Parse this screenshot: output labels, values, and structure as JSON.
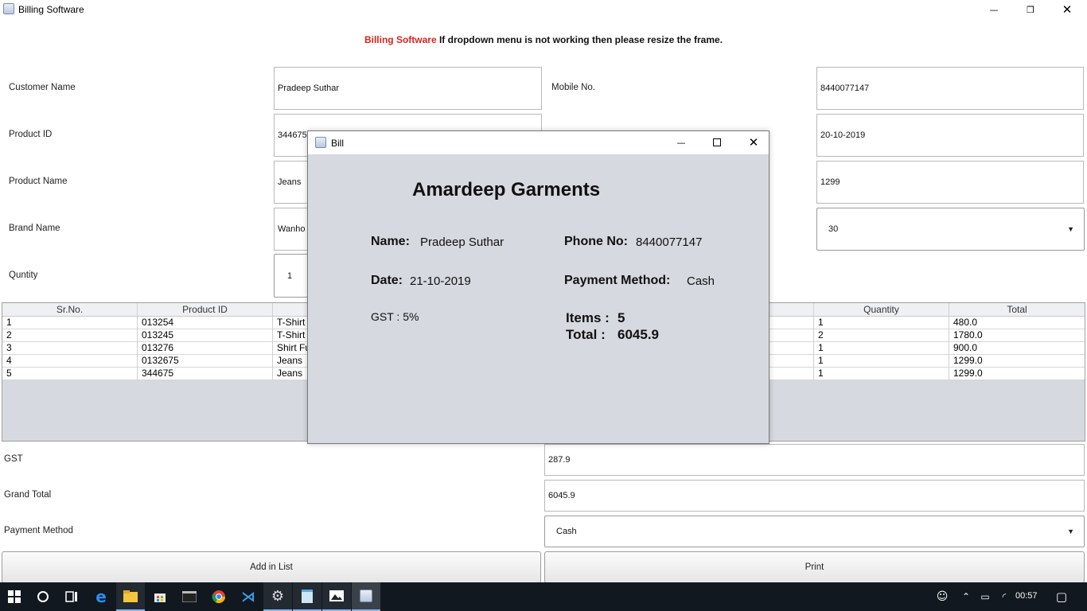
{
  "window": {
    "title": "Billing Software",
    "minimize_glyph": "—",
    "restore_glyph": "❐",
    "close_glyph": "✕"
  },
  "banner": {
    "highlight": "Billing Software",
    "message": " If dropdown menu is not working then please resize the frame."
  },
  "form": {
    "customer_name_label": "Customer Name",
    "customer_name_value": "Pradeep Suthar",
    "mobile_label": "Mobile No.",
    "mobile_value": "8440077147",
    "product_id_label": "Product ID",
    "product_id_value": "344675",
    "date_value": "20-10-2019",
    "product_name_label": "Product Name",
    "product_name_value": "Jeans",
    "price_value": "1299",
    "brand_name_label": "Brand Name",
    "brand_name_value": "Wanho",
    "size_value": "30",
    "quantity_label": "Quntity",
    "quantity_value": "1"
  },
  "table": {
    "columns": [
      "Sr.No.",
      "Product ID",
      "",
      "",
      "",
      "",
      "Quantity",
      "Total"
    ],
    "rows": [
      [
        "1",
        "013254",
        "T-Shirt",
        "1",
        "480.0"
      ],
      [
        "2",
        "013245",
        "T-Shirt",
        "2",
        "1780.0"
      ],
      [
        "3",
        "013276",
        "Shirt Fu",
        "1",
        "900.0"
      ],
      [
        "4",
        "0132675",
        "Jeans",
        "1",
        "1299.0"
      ],
      [
        "5",
        "344675",
        "Jeans",
        "1",
        "1299.0"
      ]
    ]
  },
  "totals": {
    "gst_label": "GST",
    "gst_value": "287.9",
    "grand_total_label": "Grand Total",
    "grand_total_value": "6045.9",
    "payment_label": "Payment Method",
    "payment_value": "Cash"
  },
  "buttons": {
    "add": "Add in List",
    "print": "Print"
  },
  "bill": {
    "title": "Bill",
    "shop_name": "Amardeep Garments",
    "name_label": "Name:",
    "name_value": "Pradeep Suthar",
    "phone_label": "Phone No:",
    "phone_value": "8440077147",
    "date_label": "Date:",
    "date_value": "21-10-2019",
    "payment_label": "Payment Method:",
    "payment_value": "Cash",
    "gst_text": "GST : 5%",
    "items_label": "Items :",
    "items_value": "5",
    "total_label": "Total :",
    "total_value": "6045.9"
  },
  "taskbar": {
    "time": "00:57",
    "icons": [
      "windows-start-icon",
      "search-icon",
      "task-view-icon",
      "edge-icon",
      "file-explorer-icon",
      "store-icon",
      "cmd-icon",
      "chrome-icon",
      "vscode-icon",
      "settings-icon",
      "notepad-icon",
      "photos-icon",
      "java-icon"
    ]
  }
}
